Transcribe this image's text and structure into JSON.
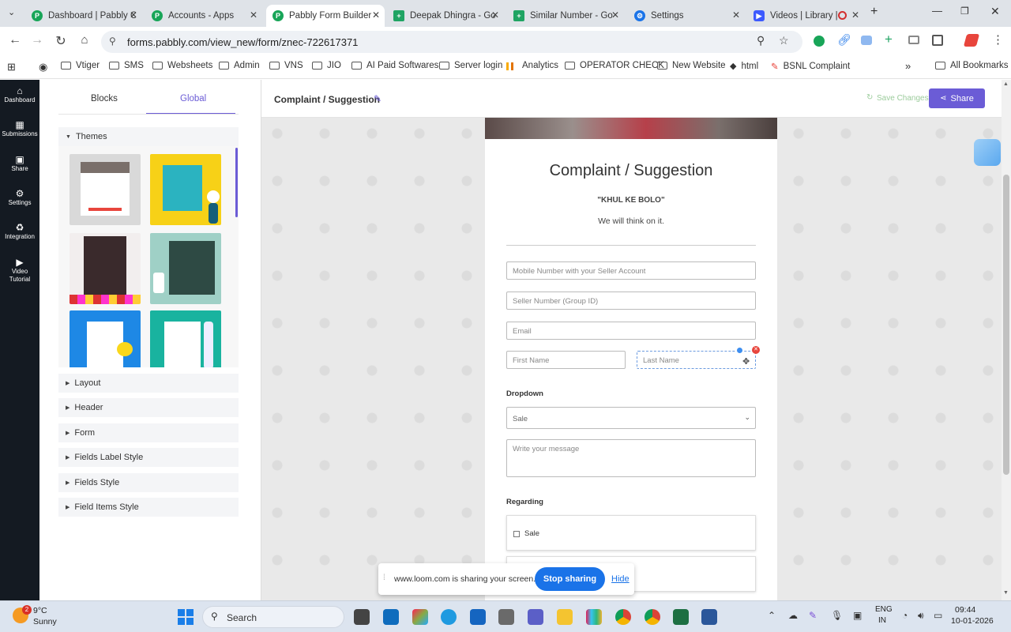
{
  "browser": {
    "tabs": [
      {
        "title": "Dashboard | Pabbly C",
        "fav": "P",
        "color": "#18a558"
      },
      {
        "title": "Accounts - Apps",
        "fav": "P",
        "color": "#18a558"
      },
      {
        "title": "Pabbly Form Builder",
        "fav": "P",
        "color": "#18a558"
      },
      {
        "title": "Deepak Dhingra - Go",
        "fav": "+",
        "color": "#1fa463"
      },
      {
        "title": "Similar Number - Go",
        "fav": "+",
        "color": "#1fa463"
      },
      {
        "title": "Settings",
        "fav": "⚙",
        "color": "#1a73e8"
      },
      {
        "title": "Videos | Library |",
        "fav": "▶",
        "color": "#3d5afe"
      }
    ],
    "url": "forms.pabbly.com/view_new/form/znec-722617371",
    "bookmarks": [
      "Vtiger",
      "SMS",
      "Websheets",
      "Admin",
      "VNS",
      "JIO",
      "AI Paid Softwares",
      "Server login",
      "Analytics",
      "OPERATOR CHECK",
      "New Website",
      "html",
      "BSNL Complaint"
    ],
    "all_bookmarks": "All Bookmarks"
  },
  "sidebar": {
    "items": [
      "Dashboard",
      "Submissions",
      "Share",
      "Settings",
      "Integration",
      "Video Tutorial"
    ]
  },
  "panel": {
    "tabs": [
      "Blocks",
      "Global"
    ],
    "themes_label": "Themes",
    "sections": [
      "Layout",
      "Header",
      "Form",
      "Fields Label Style",
      "Fields Style",
      "Field Items Style"
    ]
  },
  "header": {
    "title": "Complaint / Suggestion",
    "save_label": "Save Changes",
    "share_label": "Share"
  },
  "form": {
    "title": "Complaint / Suggestion",
    "subtitle": "\"KHUL KE BOLO\"",
    "description": "We will think on it.",
    "placeholders": {
      "mobile": "Mobile Number with your Seller Account",
      "seller": "Seller Number (Group ID)",
      "email": "Email",
      "first": "First Name",
      "last": "Last Name",
      "message": "Write your message"
    },
    "dropdown_label": "Dropdown",
    "dropdown_value": "Sale",
    "regarding_label": "Regarding",
    "option1": "Sale"
  },
  "loom": {
    "text": "www.loom.com is sharing your screen.",
    "stop": "Stop sharing",
    "hide": "Hide"
  },
  "taskbar": {
    "badge": "2",
    "temp": "9°C",
    "weather": "Sunny",
    "search": "Search",
    "lang1": "ENG",
    "lang2": "IN",
    "time": "09:44",
    "date": "10-01-2026"
  }
}
